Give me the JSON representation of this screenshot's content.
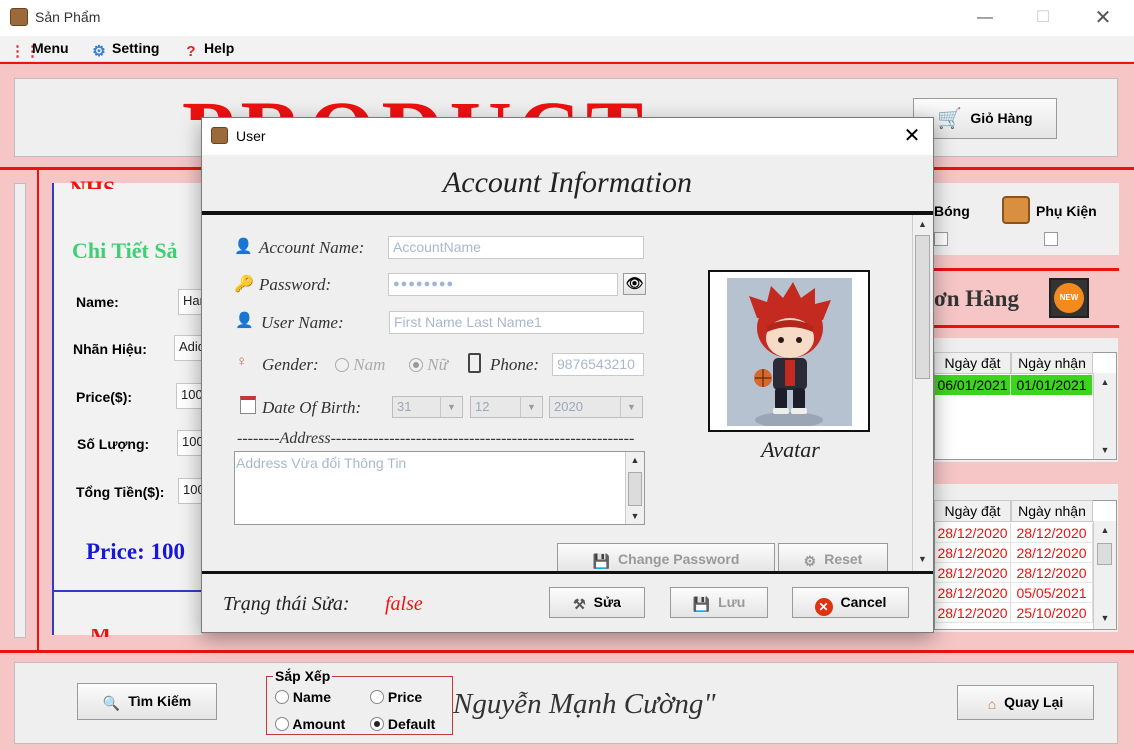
{
  "window": {
    "title": "Sản Phẩm"
  },
  "menu": {
    "items": [
      "Menu",
      "Setting",
      "Help"
    ]
  },
  "header": {
    "logo_text": "PRODUCT",
    "cart_button": "Giỏ Hàng"
  },
  "left_panel": {
    "title": "Chi Tiết Sả",
    "fields": [
      {
        "label": "Name:",
        "value": "Har"
      },
      {
        "label": "Nhãn Hiệu:",
        "value": "Adid"
      },
      {
        "label": "Price($):",
        "value": "100"
      },
      {
        "label": "Số Lượng:",
        "value": "100"
      },
      {
        "label": "Tổng Tiền($):",
        "value": "100"
      }
    ],
    "price_text": "Price: 100"
  },
  "right_panel": {
    "categories": [
      "Bóng",
      "Phụ Kiện"
    ],
    "orders_title": "ơn Hàng",
    "orders_badge": "NEW",
    "table1": {
      "headers": [
        "Ngày đặt",
        "Ngày nhận"
      ],
      "rows": [
        [
          "06/01/2021",
          "01/01/2021"
        ]
      ]
    },
    "table2": {
      "headers": [
        "Ngày đặt",
        "Ngày nhận"
      ],
      "rows": [
        [
          "28/12/2020",
          "28/12/2020"
        ],
        [
          "28/12/2020",
          "28/12/2020"
        ],
        [
          "28/12/2020",
          "28/12/2020"
        ],
        [
          "28/12/2020",
          "05/05/2021"
        ],
        [
          "28/12/2020",
          "25/10/2020"
        ]
      ]
    }
  },
  "bottom": {
    "search_button": "Tìm Kiếm",
    "sort_legend": "Sắp Xếp",
    "sort_options": [
      "Name",
      "Price",
      "Amount",
      "Default"
    ],
    "sort_selected": "Default",
    "author_text": "Nguyễn Mạnh Cường\"",
    "back_button": "Quay Lại"
  },
  "dialog": {
    "title": "User",
    "heading": "Account Information",
    "account_name_label": "Account Name:",
    "account_name_value": "AccountName",
    "password_label": "Password:",
    "password_value": "●●●●●●●●",
    "user_name_label": "User Name:",
    "user_name_value": "First Name Last Name1",
    "gender_label": "Gender:",
    "gender_options": [
      "Nam",
      "Nữ"
    ],
    "gender_selected": "Nữ",
    "phone_label": "Phone:",
    "phone_value": "9876543210",
    "dob_label": "Date Of Birth:",
    "dob_day": "31",
    "dob_month": "12",
    "dob_year": "2020",
    "address_label": "--------Address---------------------------------------------------------",
    "address_value": "Address Vừa đổi Thông Tin",
    "change_password_button": "Change Password",
    "reset_button": "Reset",
    "avatar_label": "Avatar",
    "status_label": "Trạng thái Sửa:",
    "status_value": "false",
    "edit_button": "Sửa",
    "save_button": "Lưu",
    "cancel_button": "Cancel"
  }
}
